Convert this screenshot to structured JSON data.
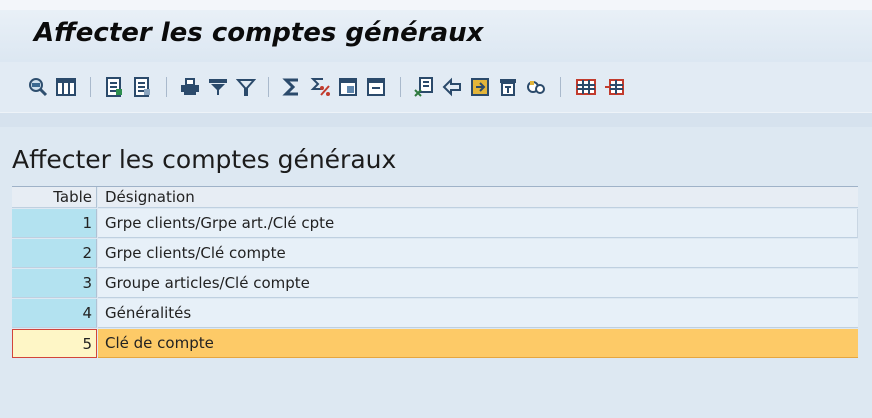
{
  "window": {
    "title": "Affecter les comptes généraux"
  },
  "toolbar": {
    "buttons": [
      {
        "icon": "details-icon"
      },
      {
        "icon": "choose-layout-icon"
      },
      {
        "icon": "select-all-icon"
      },
      {
        "icon": "deselect-all-icon"
      },
      {
        "icon": "print-icon"
      },
      {
        "icon": "filter-icon"
      },
      {
        "icon": "delete-filter-icon"
      },
      {
        "icon": "sum-icon"
      },
      {
        "icon": "subtotal-icon"
      },
      {
        "icon": "expand-icon"
      },
      {
        "icon": "collapse-icon"
      },
      {
        "icon": "export-icon"
      },
      {
        "icon": "sort-icon"
      },
      {
        "icon": "find-icon"
      },
      {
        "icon": "print-preview-icon"
      },
      {
        "icon": "find-next-icon"
      },
      {
        "icon": "table-icon"
      },
      {
        "icon": "more-icon"
      }
    ]
  },
  "content": {
    "heading": "Affecter les comptes généraux",
    "columns": [
      "Table",
      "Désignation"
    ],
    "rows": [
      {
        "table": "1",
        "designation": "Grpe clients/Grpe art./Clé cpte"
      },
      {
        "table": "2",
        "designation": "Grpe clients/Clé compte"
      },
      {
        "table": "3",
        "designation": "Groupe articles/Clé compte"
      },
      {
        "table": "4",
        "designation": "Généralités"
      },
      {
        "table": "5",
        "designation": "Clé de compte"
      }
    ]
  },
  "colors": {
    "selected_row": "#fdca67",
    "key_cell": "#b3e2f0",
    "selected_border": "#d2453b"
  }
}
